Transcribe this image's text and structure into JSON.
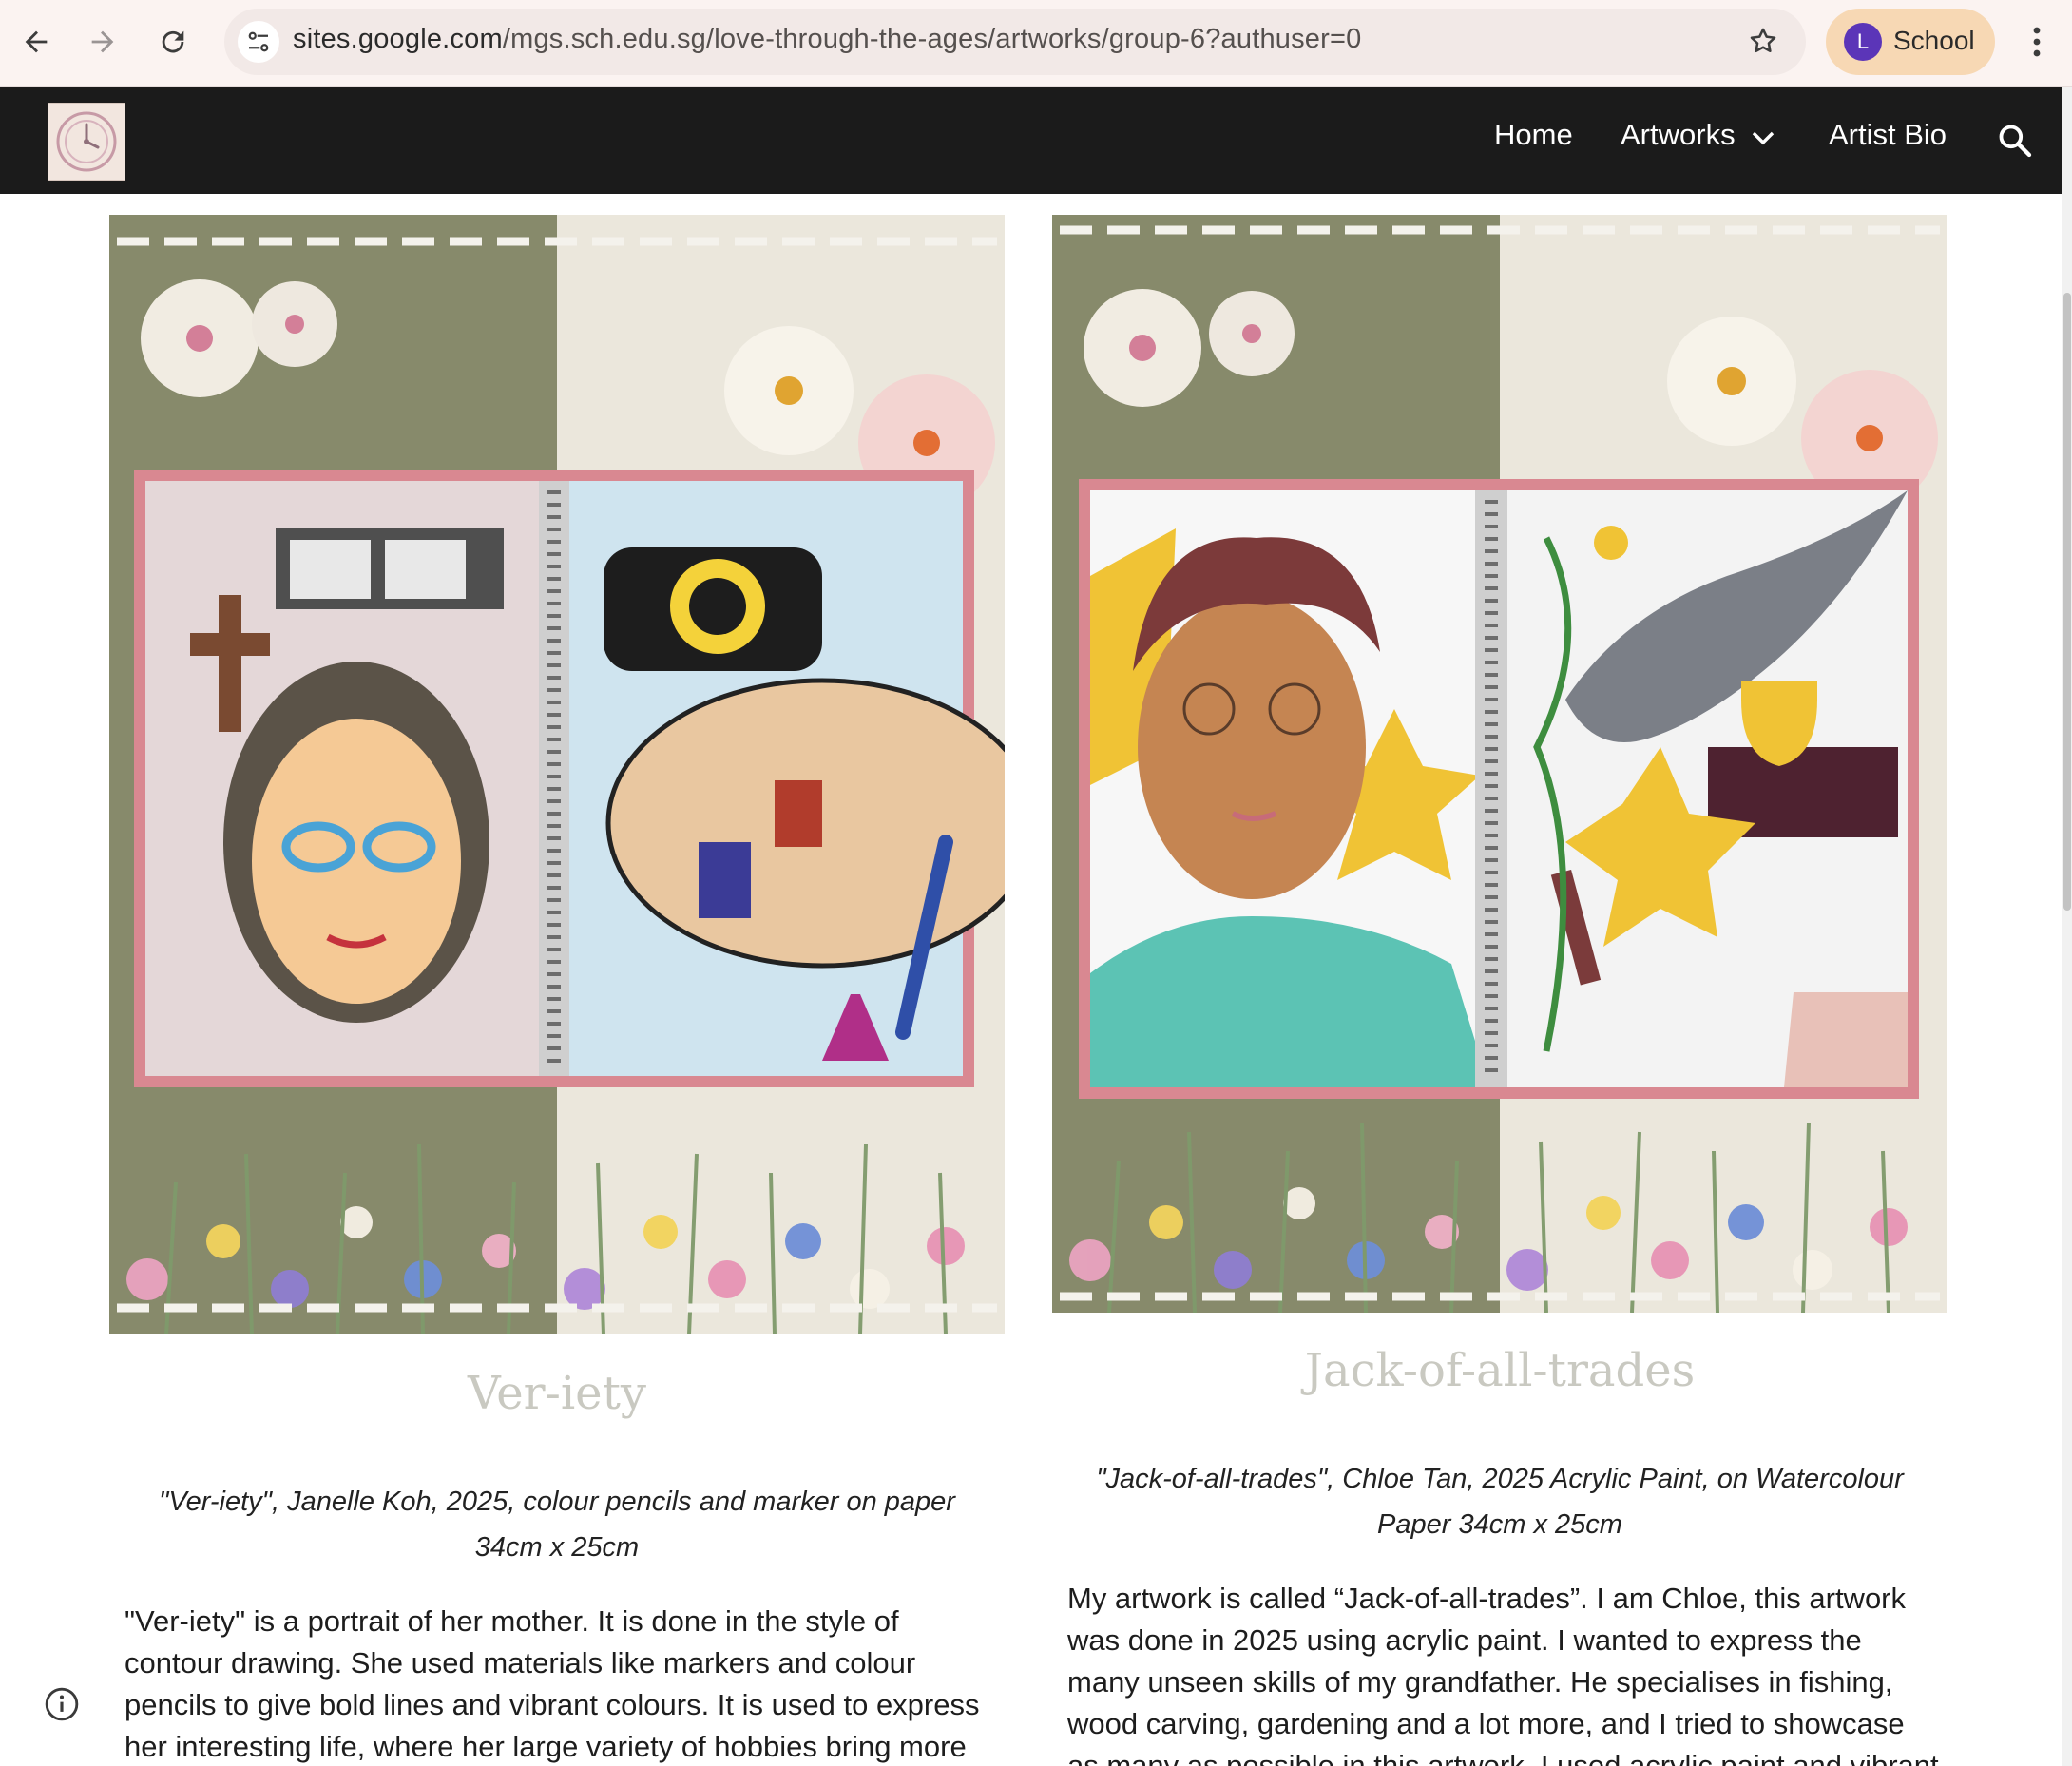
{
  "browser": {
    "url_host": "sites.google.com",
    "url_path": "/mgs.sch.edu.sg/love-through-the-ages/artworks/group-6?authuser=0",
    "profile_initial": "L",
    "profile_label": "School",
    "icons": [
      "back-arrow-icon",
      "forward-arrow-icon",
      "reload-icon",
      "site-info-icon",
      "bookmark-star-icon",
      "more-menu-icon"
    ]
  },
  "site": {
    "nav": {
      "home": "Home",
      "artworks": "Artworks",
      "artist_bio": "Artist Bio"
    }
  },
  "artworks": [
    {
      "title": "Ver-iety",
      "caption_line1": "\"Ver-iety\", Janelle Koh, 2025, colour pencils and marker on paper",
      "caption_line2": "34cm x 25cm",
      "description": "\"Ver-iety\" is a portrait of her mother. It is done in the style of contour drawing. She used materials like markers and colour pencils to give bold lines and vibrant colours. It is used to express her interesting life, where her large variety of hobbies bring more"
    },
    {
      "title": "Jack-of-all-trades",
      "caption_line1": "\"Jack-of-all-trades\", Chloe Tan, 2025 Acrylic Paint, on Watercolour",
      "caption_line2": "Paper 34cm x 25cm",
      "description": "My artwork is called “Jack-of-all-trades”. I am Chloe, this artwork was done in 2025 using acrylic paint. I wanted to express the many unseen skills of my grandfather. He specialises in fishing, wood carving, gardening and a lot more, and I tried to showcase as many as possible in this artwork. I used acrylic paint and vibrant colours"
    }
  ],
  "colors": {
    "olive_panel": "#878a6b",
    "cream_panel": "#ebe7dc",
    "frame_pink": "#d98891",
    "header_bg": "#1b1b1b",
    "title_grey": "#c9c9c1"
  }
}
